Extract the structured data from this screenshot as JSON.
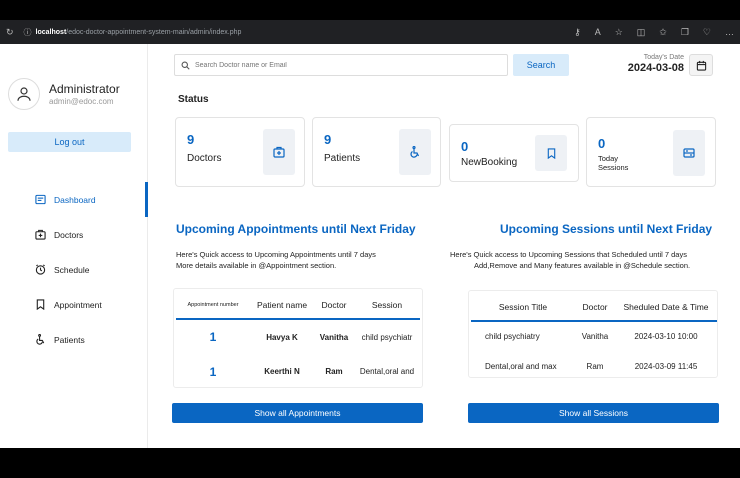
{
  "browser": {
    "host": "localhost",
    "path": "/edoc-doctor-appointment-system-main/admin/index.php"
  },
  "profile": {
    "name": "Administrator",
    "email": "admin@edoc.com",
    "logout": "Log out"
  },
  "menu": [
    {
      "label": "Dashboard",
      "icon": "dashboard-icon",
      "active": true
    },
    {
      "label": "Doctors",
      "icon": "doctor-icon",
      "active": false
    },
    {
      "label": "Schedule",
      "icon": "clock-icon",
      "active": false
    },
    {
      "label": "Appointment",
      "icon": "bookmark-icon",
      "active": false
    },
    {
      "label": "Patients",
      "icon": "wheelchair-icon",
      "active": false
    }
  ],
  "search": {
    "placeholder": "Search Doctor name or Email",
    "button": "Search"
  },
  "date": {
    "label": "Today's Date",
    "value": "2024-03-08"
  },
  "status_title": "Status",
  "cards": [
    {
      "value": "9",
      "label": "Doctors",
      "icon": "doctor-icon"
    },
    {
      "value": "9",
      "label": "Patients",
      "icon": "wheelchair-icon"
    },
    {
      "value": "0",
      "label": "NewBooking",
      "icon": "bookmark-icon"
    },
    {
      "value": "0",
      "label_line1": "Today",
      "label_line2": "Sessions",
      "icon": "sessions-icon"
    }
  ],
  "appointments": {
    "title": "Upcoming Appointments until Next Friday",
    "desc_line1": "Here's Quick access to Upcoming Appointments until 7 days",
    "desc_line2": "More details available in @Appointment section.",
    "columns": [
      "Appointment number",
      "Patient name",
      "Doctor",
      "Session"
    ],
    "rows": [
      [
        "1",
        "Havya K",
        "Vanitha",
        "child psychiatr"
      ],
      [
        "1",
        "Keerthi N",
        "Ram",
        "Dental,oral and"
      ]
    ],
    "button": "Show all Appointments"
  },
  "sessions": {
    "title": "Upcoming Sessions until Next Friday",
    "desc_line1": "Here's Quick access to Upcoming Sessions that Scheduled until 7 days",
    "desc_line2": "Add,Remove and Many features available in @Schedule section.",
    "columns": [
      "Session Title",
      "Doctor",
      "Sheduled Date & Time"
    ],
    "rows": [
      [
        "child psychiatry",
        "Vanitha",
        "2024-03-10 10:00"
      ],
      [
        "Dental,oral and max",
        "Ram",
        "2024-03-09 11:45"
      ]
    ],
    "button": "Show all Sessions"
  },
  "colors": {
    "accent": "#0a66c2",
    "accent_light": "#d8ebfa"
  }
}
